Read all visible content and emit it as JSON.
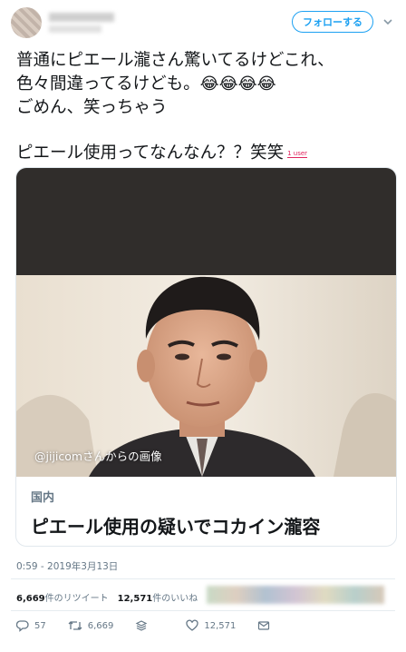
{
  "header": {
    "follow_label": "フォローする"
  },
  "tweet": {
    "lines": [
      "普通にピエール瀧さん驚いてるけどこれ、",
      "色々間違ってるけども。",
      "ごめん、笑っちゃう",
      "ピエール使用ってなんなん？？笑笑"
    ],
    "emoji": "😂😂😂😂",
    "badge": "1 user"
  },
  "card": {
    "image_credit": "@jijicomさんからの画像",
    "category": "国内",
    "headline": "ピエール使用の疑いでコカイン瀧容"
  },
  "timestamp": "0:59 - 2019年3月13日",
  "stats": {
    "retweets_count": "6,669",
    "retweets_label": "件のリツイート",
    "likes_count": "12,571",
    "likes_label": "件のいいね"
  },
  "actions": {
    "replies": "57",
    "retweets": "6,669",
    "likes": "12,571"
  },
  "colors": {
    "accent": "#1da1f2",
    "text": "#14171a",
    "muted": "#657786",
    "card_dark": "#302d2b"
  }
}
